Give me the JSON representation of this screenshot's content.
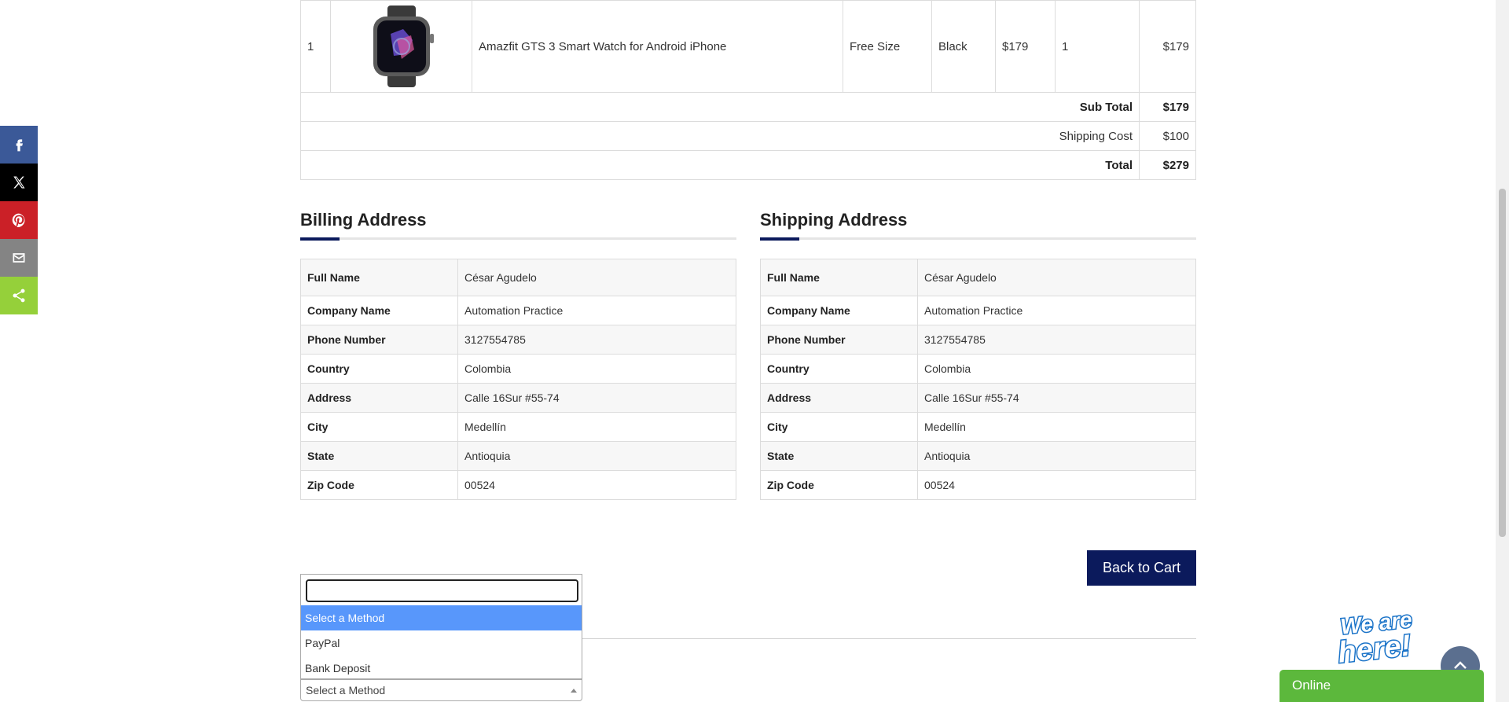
{
  "share": {
    "buttons": [
      "facebook-icon",
      "x-icon",
      "pinterest-icon",
      "email-icon",
      "share-icon"
    ],
    "colors": {
      "facebook": "#3b5998",
      "x": "#000000",
      "pinterest": "#cb2027",
      "email": "#848484",
      "share": "#95d03a"
    }
  },
  "cart": {
    "item": {
      "index": "1",
      "name": "Amazfit GTS 3 Smart Watch for Android iPhone",
      "size": "Free Size",
      "color": "Black",
      "price": "$179",
      "quantity": "1",
      "total": "$179"
    },
    "subtotal_label": "Sub Total",
    "subtotal_value": "$179",
    "shipping_label": "Shipping Cost",
    "shipping_value": "$100",
    "total_label": "Total",
    "total_value": "$279"
  },
  "billing": {
    "title": "Billing Address",
    "rows": [
      {
        "label": "Full Name",
        "value": "César Agudelo"
      },
      {
        "label": "Company Name",
        "value": "Automation Practice"
      },
      {
        "label": "Phone Number",
        "value": "3127554785"
      },
      {
        "label": "Country",
        "value": "Colombia"
      },
      {
        "label": "Address",
        "value": "Calle 16Sur #55-74"
      },
      {
        "label": "City",
        "value": "Medellín"
      },
      {
        "label": "State",
        "value": "Antioquia"
      },
      {
        "label": "Zip Code",
        "value": "00524"
      }
    ]
  },
  "shipping": {
    "title": "Shipping Address",
    "rows": [
      {
        "label": "Full Name",
        "value": "César Agudelo"
      },
      {
        "label": "Company Name",
        "value": "Automation Practice"
      },
      {
        "label": "Phone Number",
        "value": "3127554785"
      },
      {
        "label": "Country",
        "value": "Colombia"
      },
      {
        "label": "Address",
        "value": "Calle 16Sur #55-74"
      },
      {
        "label": "City",
        "value": "Medellín"
      },
      {
        "label": "State",
        "value": "Antioquia"
      },
      {
        "label": "Zip Code",
        "value": "00524"
      }
    ]
  },
  "back_to_cart": "Back to Cart",
  "payment": {
    "search_value": "",
    "options": [
      "Select a Method",
      "PayPal",
      "Bank Deposit"
    ],
    "selected": "Select a Method"
  },
  "chat": {
    "badge_text": "We are here!",
    "status": "Online"
  },
  "colors": {
    "accent": "#0b1a5c",
    "highlight": "#5897fb",
    "chat": "#5cb83c"
  }
}
